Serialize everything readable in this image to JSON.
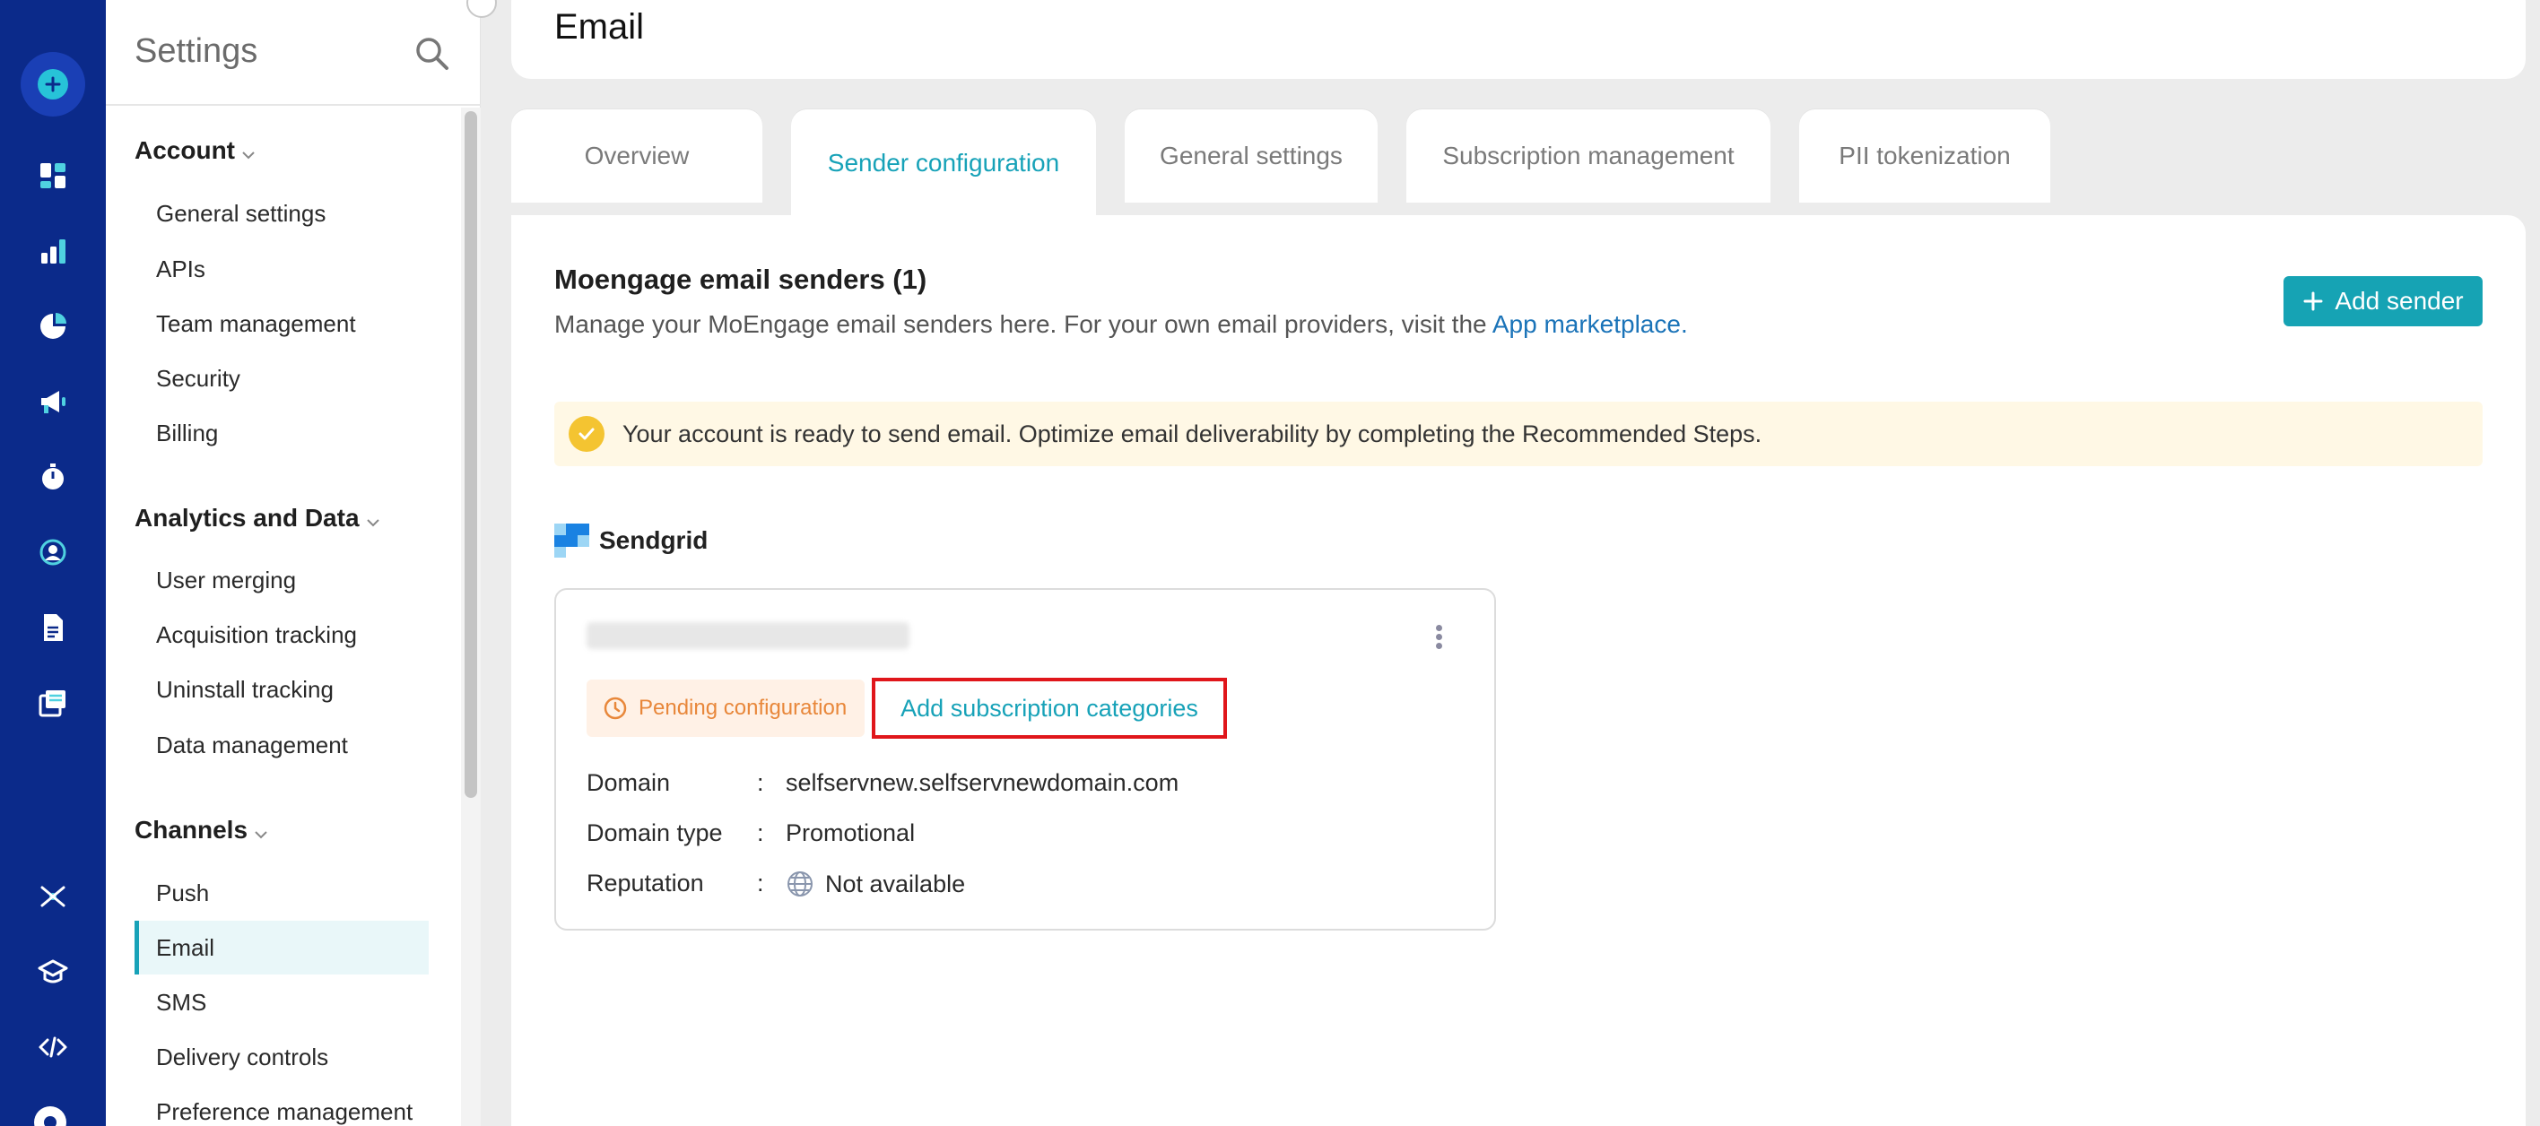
{
  "sidebar": {
    "title": "Settings",
    "groups": [
      {
        "label": "Account",
        "items": [
          "General settings",
          "APIs",
          "Team management",
          "Security",
          "Billing"
        ]
      },
      {
        "label": "Analytics and Data",
        "items": [
          "User merging",
          "Acquisition tracking",
          "Uninstall tracking",
          "Data management"
        ]
      },
      {
        "label": "Channels",
        "items": [
          "Push",
          "Email",
          "SMS",
          "Delivery controls",
          "Preference management"
        ]
      }
    ],
    "active_item": "Email"
  },
  "header": {
    "title": "Email"
  },
  "tabs": [
    {
      "label": "Overview"
    },
    {
      "label": "Sender configuration"
    },
    {
      "label": "General settings"
    },
    {
      "label": "Subscription management"
    },
    {
      "label": "PII tokenization"
    }
  ],
  "active_tab": "Sender configuration",
  "section": {
    "title": "Moengage email senders (1)",
    "description": "Manage your MoEngage email senders here. For your own email providers, visit the ",
    "link_label": "App marketplace.",
    "add_button": "Add sender"
  },
  "banner": {
    "text": "Your account is ready to send email. Optimize email deliverability by completing the Recommended Steps."
  },
  "provider": {
    "name": "Sendgrid"
  },
  "sender_card": {
    "status": "Pending configuration",
    "action": "Add subscription categories",
    "fields": [
      {
        "key": "Domain",
        "sep": ":",
        "value": "selfservnew.selfservnewdomain.com"
      },
      {
        "key": "Domain type",
        "sep": ":",
        "value": "Promotional"
      },
      {
        "key": "Reputation",
        "sep": ":",
        "value": "Not available"
      }
    ]
  },
  "colors": {
    "rail": "#0b2a8a",
    "accent": "#16a3b4",
    "highlight_border": "#e0161b",
    "pending": "#e8873a"
  }
}
